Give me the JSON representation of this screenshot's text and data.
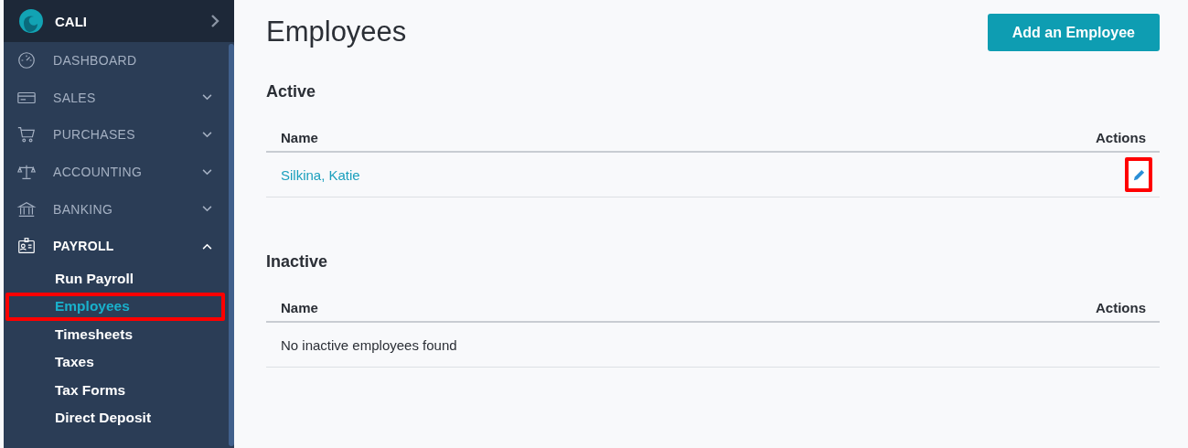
{
  "sidebar": {
    "brand": "CALI",
    "items": [
      {
        "label": "DASHBOARD",
        "selected": false
      },
      {
        "label": "SALES",
        "expanded": false,
        "selected": false
      },
      {
        "label": "PURCHASES",
        "expanded": false,
        "selected": false
      },
      {
        "label": "ACCOUNTING",
        "expanded": false,
        "selected": false
      },
      {
        "label": "BANKING",
        "expanded": false,
        "selected": false
      },
      {
        "label": "PAYROLL",
        "expanded": true,
        "selected": true,
        "children": [
          {
            "label": "Run Payroll",
            "selected": false,
            "highlighted": false
          },
          {
            "label": "Employees",
            "selected": true,
            "highlighted": true
          },
          {
            "label": "Timesheets",
            "selected": false,
            "highlighted": false
          },
          {
            "label": "Taxes",
            "selected": false,
            "highlighted": false
          },
          {
            "label": "Tax Forms",
            "selected": false,
            "highlighted": false
          },
          {
            "label": "Direct Deposit",
            "selected": false,
            "highlighted": false
          }
        ]
      }
    ]
  },
  "page": {
    "title": "Employees",
    "add_button": "Add an Employee",
    "sections": [
      {
        "heading": "Active",
        "columns": [
          "Name",
          "Actions"
        ],
        "rows": [
          {
            "name": "Silkina, Katie",
            "edit_highlighted": true
          }
        ]
      },
      {
        "heading": "Inactive",
        "columns": [
          "Name",
          "Actions"
        ],
        "empty_text": "No inactive employees found"
      }
    ]
  }
}
